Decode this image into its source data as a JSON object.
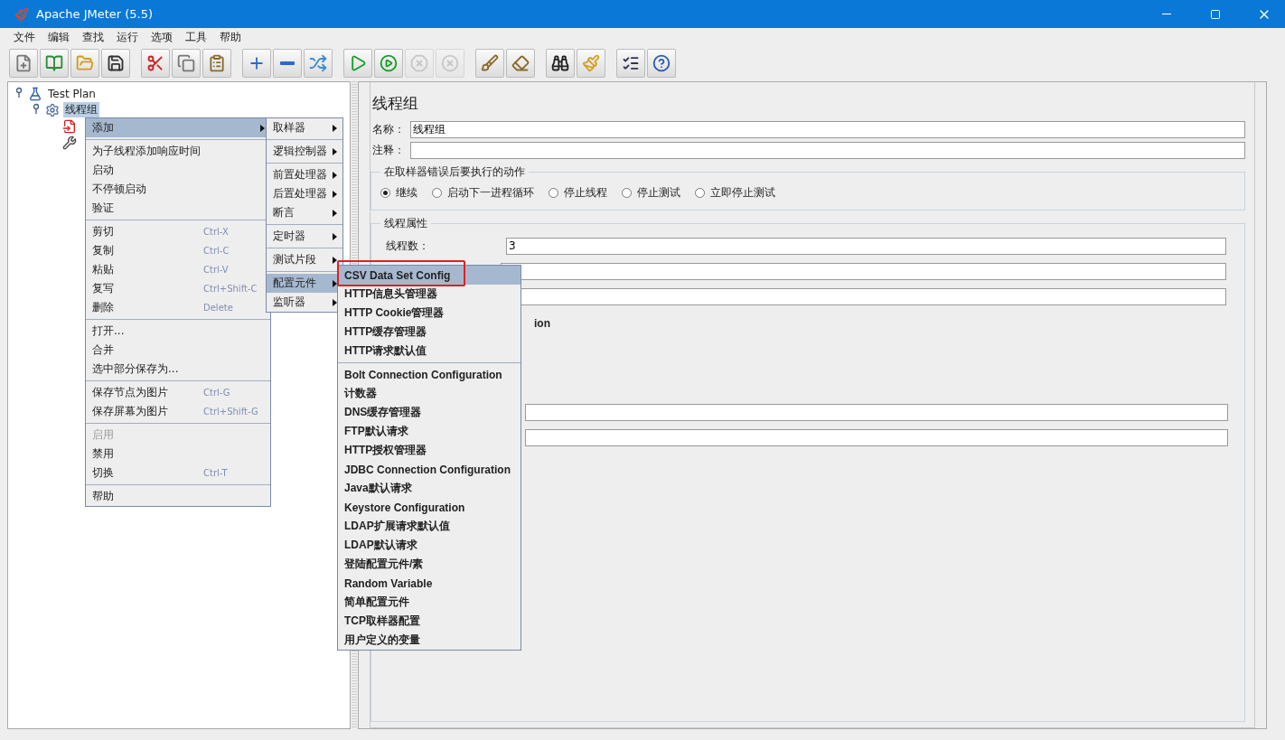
{
  "window": {
    "title": "Apache JMeter (5.5)"
  },
  "menu_bar": [
    "文件",
    "编辑",
    "查找",
    "运行",
    "选项",
    "工具",
    "帮助"
  ],
  "toolbar": [
    [
      {
        "disabled": false
      },
      {
        "disabled": false
      },
      {
        "disabled": false
      },
      {
        "disabled": false
      }
    ],
    [
      {
        "disabled": false
      },
      {
        "disabled": false
      },
      {
        "disabled": false
      }
    ],
    [
      {
        "disabled": false
      },
      {
        "disabled": false
      },
      {
        "disabled": false
      }
    ],
    [
      {
        "disabled": false
      },
      {
        "disabled": false
      },
      {
        "disabled": true
      },
      {
        "disabled": true
      }
    ],
    [
      {
        "disabled": false
      },
      {
        "disabled": false
      }
    ],
    [
      {
        "disabled": false
      },
      {
        "disabled": false
      }
    ],
    [
      {
        "disabled": false
      },
      {
        "disabled": false
      }
    ]
  ],
  "tree": [
    {
      "kind": "plan",
      "label": "Test Plan",
      "selected": false,
      "expanded": true,
      "children": [
        {
          "kind": "thread-group",
          "label": "线程组",
          "selected": true,
          "expanded": true,
          "children": [
            {
              "kind": "request"
            },
            {
              "kind": "config"
            }
          ]
        }
      ]
    }
  ],
  "panel": {
    "title": "线程组",
    "name_label": "名称：",
    "name_value": "线程组",
    "comment_label": "注释：",
    "error_action": {
      "title": "在取样器错误后要执行的动作",
      "options": [
        {
          "label": "继续",
          "selected": true
        },
        {
          "label": "启动下一进程循环",
          "selected": false
        },
        {
          "label": "停止线程",
          "selected": false
        },
        {
          "label": "停止测试",
          "selected": false
        },
        {
          "label": "立即停止测试",
          "selected": false
        }
      ]
    },
    "thread_properties": {
      "title": "线程属性",
      "thread_count_label": "线程数：",
      "thread_count_value": "3",
      "partial_label": "ion"
    }
  },
  "context_menu": {
    "sections": [
      [
        {
          "label": "添加",
          "selected": true,
          "disabled": false,
          "submenu": true
        }
      ],
      [
        {
          "label": "为子线程添加响应时间",
          "selected": false,
          "disabled": false,
          "submenu": false
        },
        {
          "label": "启动",
          "selected": false,
          "disabled": false,
          "submenu": false
        },
        {
          "label": "不停顿启动",
          "selected": false,
          "disabled": false,
          "submenu": false
        },
        {
          "label": "验证",
          "selected": false,
          "disabled": false,
          "submenu": false
        }
      ],
      [
        {
          "label": "剪切",
          "shortcut": "Ctrl-X",
          "selected": false,
          "disabled": false,
          "submenu": false
        },
        {
          "label": "复制",
          "shortcut": "Ctrl-C",
          "selected": false,
          "disabled": false,
          "submenu": false
        },
        {
          "label": "粘贴",
          "shortcut": "Ctrl-V",
          "selected": false,
          "disabled": false,
          "submenu": false
        },
        {
          "label": "复写",
          "shortcut": "Ctrl+Shift-C",
          "selected": false,
          "disabled": false,
          "submenu": false
        },
        {
          "label": "删除",
          "shortcut": "Delete",
          "selected": false,
          "disabled": false,
          "submenu": false
        }
      ],
      [
        {
          "label": "打开...",
          "selected": false,
          "disabled": false,
          "submenu": false
        },
        {
          "label": "合并",
          "selected": false,
          "disabled": false,
          "submenu": false
        },
        {
          "label": "选中部分保存为...",
          "selected": false,
          "disabled": false,
          "submenu": false
        }
      ],
      [
        {
          "label": "保存节点为图片",
          "shortcut": "Ctrl-G",
          "selected": false,
          "disabled": false,
          "submenu": false
        },
        {
          "label": "保存屏幕为图片",
          "shortcut": "Ctrl+Shift-G",
          "selected": false,
          "disabled": false,
          "submenu": false
        }
      ],
      [
        {
          "label": "启用",
          "selected": false,
          "disabled": true,
          "submenu": false
        },
        {
          "label": "禁用",
          "selected": false,
          "disabled": false,
          "submenu": false
        },
        {
          "label": "切换",
          "shortcut": "Ctrl-T",
          "selected": false,
          "disabled": false,
          "submenu": false
        }
      ],
      [
        {
          "label": "帮助",
          "selected": false,
          "disabled": false,
          "submenu": false
        }
      ]
    ]
  },
  "add_submenu": {
    "sections": [
      [
        {
          "label": "取样器",
          "selected": false
        }
      ],
      [
        {
          "label": "逻辑控制器",
          "selected": false
        }
      ],
      [
        {
          "label": "前置处理器",
          "selected": false
        },
        {
          "label": "后置处理器",
          "selected": false
        },
        {
          "label": "断言",
          "selected": false
        }
      ],
      [
        {
          "label": "定时器",
          "selected": false
        }
      ],
      [
        {
          "label": "测试片段",
          "selected": false
        }
      ],
      [
        {
          "label": "配置元件",
          "selected": true
        },
        {
          "label": "监听器",
          "selected": false
        }
      ]
    ]
  },
  "config_submenu": {
    "sections": [
      [
        {
          "label": "CSV Data Set Config",
          "selected": true
        },
        {
          "label": "HTTP信息头管理器",
          "selected": false
        },
        {
          "label": "HTTP Cookie管理器",
          "selected": false
        },
        {
          "label": "HTTP缓存管理器",
          "selected": false
        },
        {
          "label": "HTTP请求默认值",
          "selected": false
        }
      ],
      [
        {
          "label": "Bolt Connection Configuration",
          "selected": false
        },
        {
          "label": "计数器",
          "selected": false
        },
        {
          "label": "DNS缓存管理器",
          "selected": false
        },
        {
          "label": "FTP默认请求",
          "selected": false
        },
        {
          "label": "HTTP授权管理器",
          "selected": false
        },
        {
          "label": "JDBC Connection Configuration",
          "selected": false
        },
        {
          "label": "Java默认请求",
          "selected": false
        },
        {
          "label": "Keystore Configuration",
          "selected": false
        },
        {
          "label": "LDAP扩展请求默认值",
          "selected": false
        },
        {
          "label": "LDAP默认请求",
          "selected": false
        },
        {
          "label": "登陆配置元件/素",
          "selected": false
        },
        {
          "label": "Random Variable",
          "selected": false
        },
        {
          "label": "简单配置元件",
          "selected": false
        },
        {
          "label": "TCP取样器配置",
          "selected": false
        },
        {
          "label": "用户定义的变量",
          "selected": false
        }
      ]
    ]
  }
}
